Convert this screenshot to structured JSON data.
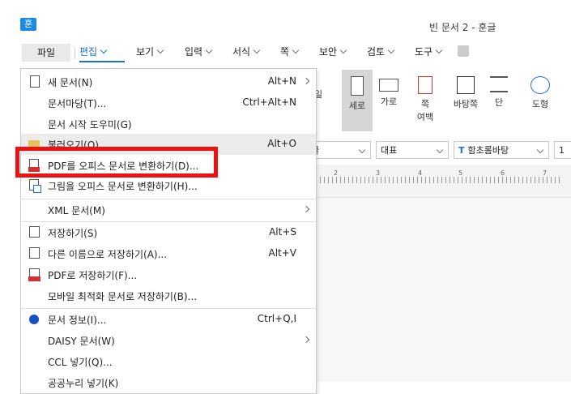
{
  "app": {
    "logo_text": "훈",
    "window_title": "빈 문서 2 - 훈글"
  },
  "menubar": {
    "tabs": [
      {
        "label": "파일"
      },
      {
        "label": "편집"
      },
      {
        "label": "보기"
      },
      {
        "label": "입력"
      },
      {
        "label": "서식"
      },
      {
        "label": "쪽"
      },
      {
        "label": "보안"
      },
      {
        "label": "검토"
      },
      {
        "label": "도구"
      }
    ]
  },
  "ribbon": {
    "portrait_label": "세로",
    "landscape_label": "가로",
    "page_margin_label": "쪽",
    "page_margin_sub": "여백",
    "facing_label": "바탕쪽",
    "columns_label": "단",
    "shape_label": "도형",
    "partial_label": "일",
    "font_lang_value": "글",
    "style_value": "대표",
    "font_value": "함초롬바탕",
    "font_size_value": "1"
  },
  "ruler": {
    "numbers": [
      "2",
      "3",
      "4",
      "5",
      "6",
      "7"
    ]
  },
  "file_menu": {
    "items": [
      {
        "label": "새 문서(N)",
        "shortcut": "Alt+N",
        "submenu": true,
        "icon": "new-document-icon"
      },
      {
        "label": "문서마당(T)...",
        "shortcut": "Ctrl+Alt+N",
        "submenu": false,
        "icon": ""
      },
      {
        "label": "문서 시작 도우미(G)",
        "shortcut": "",
        "submenu": false,
        "icon": ""
      },
      {
        "label": "불러오기(O)...",
        "shortcut": "Alt+O",
        "submenu": false,
        "icon": "folder-icon"
      },
      {
        "label": "PDF를 오피스 문서로 변환하기(D)...",
        "shortcut": "",
        "submenu": false,
        "icon": "pdf-icon"
      },
      {
        "label": "그림을 오피스 문서로 변환하기(H)...",
        "shortcut": "",
        "submenu": false,
        "icon": "image-convert-icon"
      },
      {
        "label": "XML 문서(M)",
        "shortcut": "",
        "submenu": true,
        "icon": ""
      },
      {
        "label": "저장하기(S)",
        "shortcut": "Alt+S",
        "submenu": false,
        "icon": "save-icon"
      },
      {
        "label": "다른 이름으로 저장하기(A)...",
        "shortcut": "Alt+V",
        "submenu": false,
        "icon": "save-as-icon"
      },
      {
        "label": "PDF로 저장하기(F)...",
        "shortcut": "",
        "submenu": false,
        "icon": "pdf-save-icon"
      },
      {
        "label": "모바일 최적화 문서로 저장하기(B)...",
        "shortcut": "",
        "submenu": false,
        "icon": ""
      },
      {
        "label": "문서 정보(I)...",
        "shortcut": "Ctrl+Q,I",
        "submenu": false,
        "icon": "info-icon"
      },
      {
        "label": "DAISY 문서(W)",
        "shortcut": "",
        "submenu": true,
        "icon": ""
      },
      {
        "label": "CCL 넣기(Q)...",
        "shortcut": "",
        "submenu": false,
        "icon": ""
      },
      {
        "label": "공공누리 넣기(K)",
        "shortcut": "",
        "submenu": false,
        "icon": ""
      }
    ]
  },
  "colors": {
    "accent": "#1a6fd1",
    "highlight_box": "#ee1111",
    "logo_bg": "#1a8ae6",
    "menu_hover": "#ececec"
  }
}
